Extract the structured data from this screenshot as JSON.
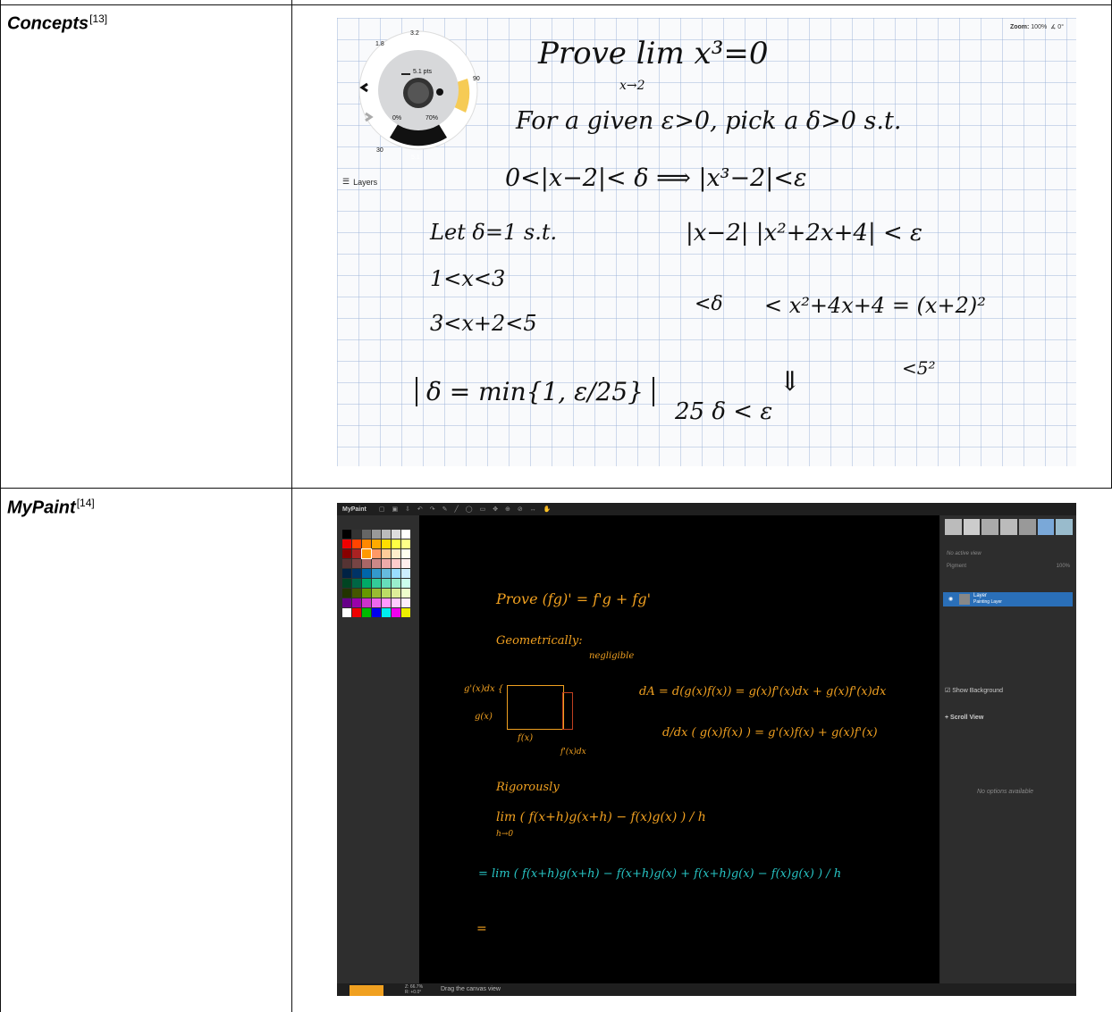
{
  "rows": [
    {
      "name": "Concepts",
      "ref": "[13]"
    },
    {
      "name": "MyPaint",
      "ref": "[14]"
    }
  ],
  "concepts": {
    "zoom_label": "Zoom:",
    "zoom_value": "100%",
    "rotation": "∡ 0°",
    "layers_label": "Layers",
    "wheel": {
      "size_text": "5.1 pts",
      "opacity_left": "0%",
      "opacity_right": "70%",
      "values": [
        "1.8",
        "3.2",
        "5.1",
        "30",
        "90"
      ]
    },
    "handwriting": [
      "Prove  lim  x³=0",
      "x→2",
      "For a given ε>0, pick a δ>0 s.t.",
      "0<|x−2|< δ ⟹ |x³−2|<ε",
      "Let δ=1  s.t.",
      "1<x<3",
      "3<x+2<5",
      "|x−2| |x²+2x+4| < ε",
      "<δ",
      "< x²+4x+4 = (x+2)²",
      "<5²",
      "δ = min{1, ε/25}",
      "25 δ < ε",
      "⇓"
    ]
  },
  "mypaint": {
    "app_title": "MyPaint",
    "layer_name": "Layer",
    "layer_type": "Painting Layer",
    "no_active_view": "No active view",
    "pigment_label": "Pigment",
    "pigment_value": "100%",
    "show_background": "Show Background",
    "scroll_view": "Scroll View",
    "no_options": "No options available",
    "status_text": "Drag the canvas view",
    "zoom_status": "Z: 66.7%",
    "rotation_status": "R: +0.0°",
    "handwriting": [
      "Prove   (fg)' = f'g + fg'",
      "Geometrically:",
      "negligible",
      "g'(x)dx {",
      "g(x)",
      "f(x)",
      "f'(x)dx",
      "dA = d(g(x)f(x)) =  g(x)f'(x)dx + g(x)f'(x)dx",
      "d/dx ( g(x)f(x) ) = g'(x)f(x) + g(x)f'(x)",
      "Rigorously",
      "lim ( f(x+h)g(x+h) − f(x)g(x) ) / h",
      "h→0",
      "= lim ( f(x+h)g(x+h) − f(x+h)g(x) + f(x+h)g(x) − f(x)g(x) ) / h",
      "="
    ]
  },
  "colors": {
    "mypaint_ink": "#f0a020",
    "mypaint_ink_alt": "#27c4c4",
    "mypaint_selected_layer": "#2a6fb8"
  }
}
